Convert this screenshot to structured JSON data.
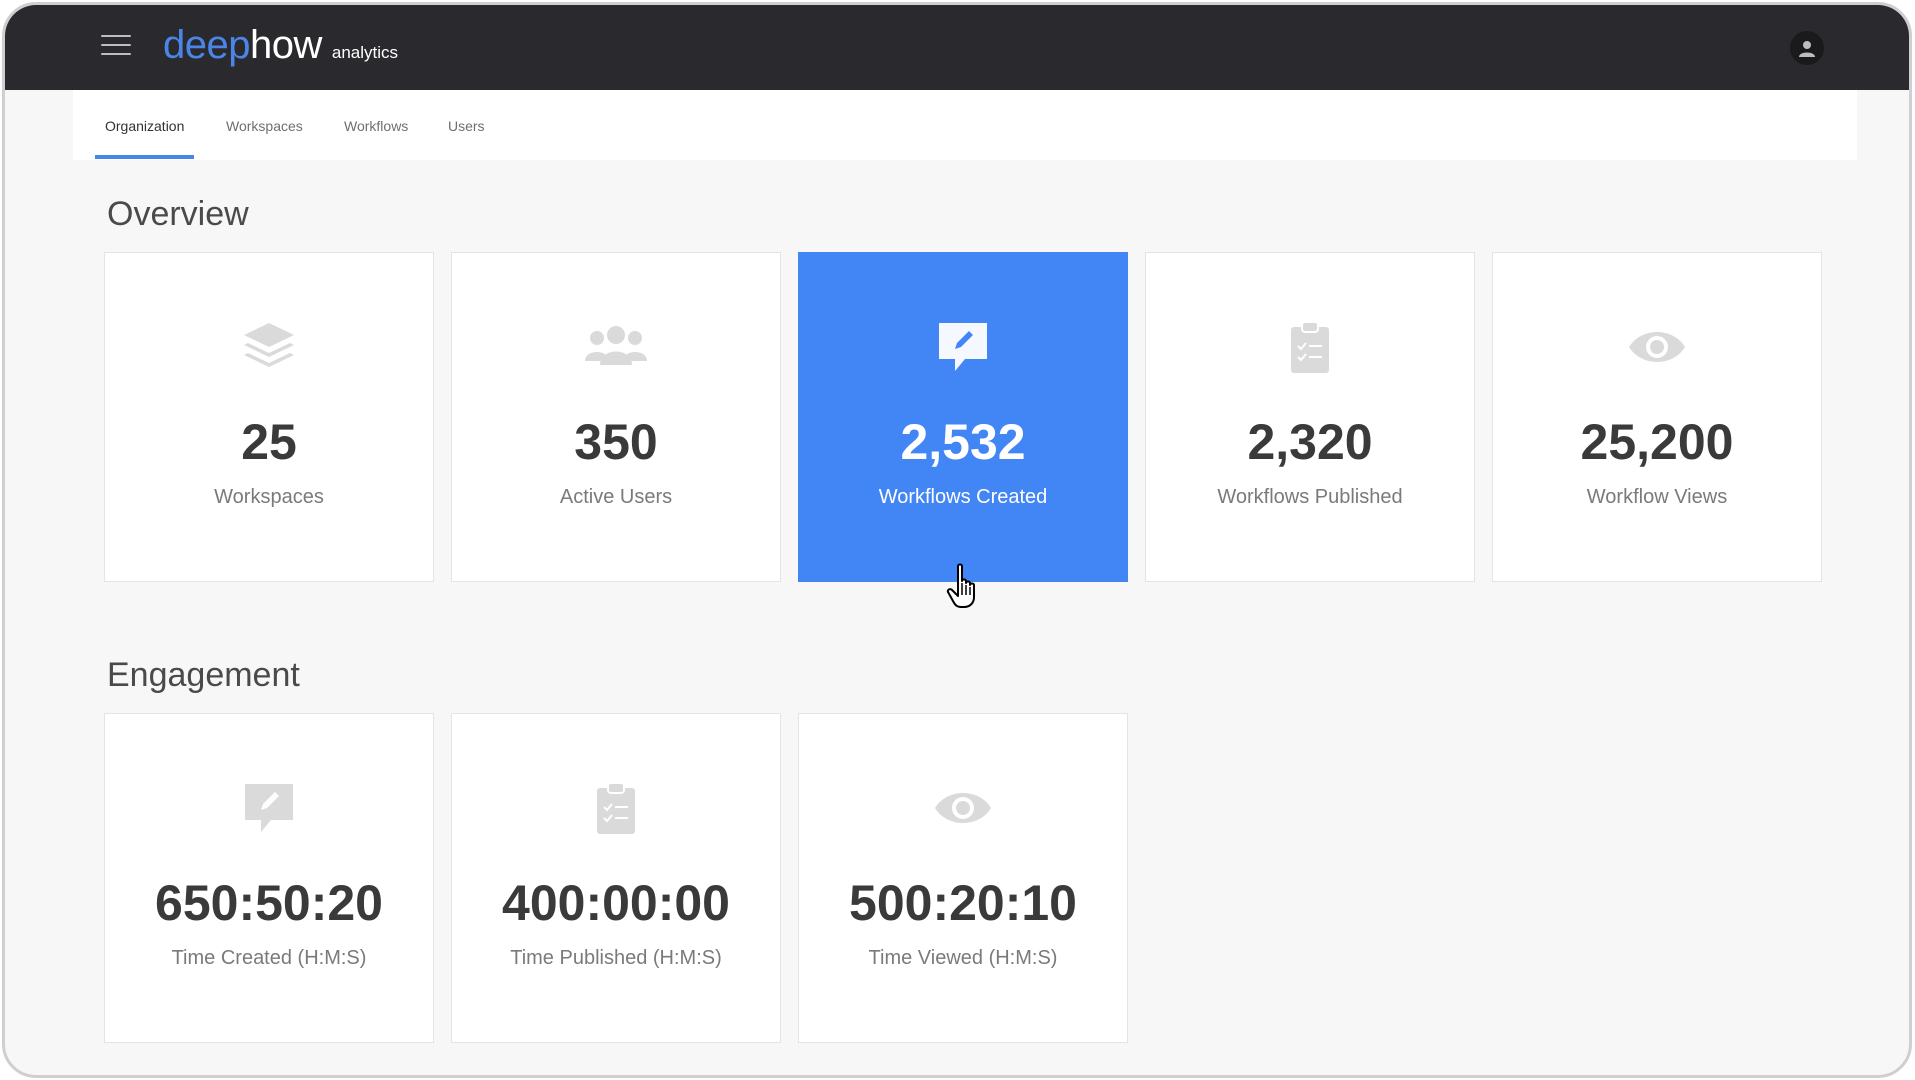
{
  "header": {
    "logo_deep": "deep",
    "logo_how": "how",
    "logo_sub": "analytics",
    "menu_icon": "hamburger-menu-icon",
    "avatar_icon": "user-avatar-icon"
  },
  "tabs": [
    {
      "label": "Organization",
      "active": true
    },
    {
      "label": "Workspaces",
      "active": false
    },
    {
      "label": "Workflows",
      "active": false
    },
    {
      "label": "Users",
      "active": false
    }
  ],
  "overview": {
    "title": "Overview",
    "cards": [
      {
        "value": "25",
        "label": "Workspaces",
        "icon": "layers-icon"
      },
      {
        "value": "350",
        "label": "Active Users",
        "icon": "users-group-icon"
      },
      {
        "value": "2,532",
        "label": "Workflows Created",
        "icon": "edit-comment-icon"
      },
      {
        "value": "2,320",
        "label": "Workflows Published",
        "icon": "clipboard-check-icon"
      },
      {
        "value": "25,200",
        "label": "Workflow Views",
        "icon": "eye-icon"
      }
    ]
  },
  "engagement": {
    "title": "Engagement",
    "cards": [
      {
        "value": "650:50:20",
        "label": "Time Created (H:M:S)",
        "icon": "edit-comment-icon"
      },
      {
        "value": "400:00:00",
        "label": "Time Published (H:M:S)",
        "icon": "clipboard-check-icon"
      },
      {
        "value": "500:20:10",
        "label": "Time Viewed (H:M:S)",
        "icon": "eye-icon"
      }
    ]
  },
  "colors": {
    "accent": "#4285f4",
    "topbar": "#2a2a2e",
    "icon_gray": "#dadada"
  }
}
